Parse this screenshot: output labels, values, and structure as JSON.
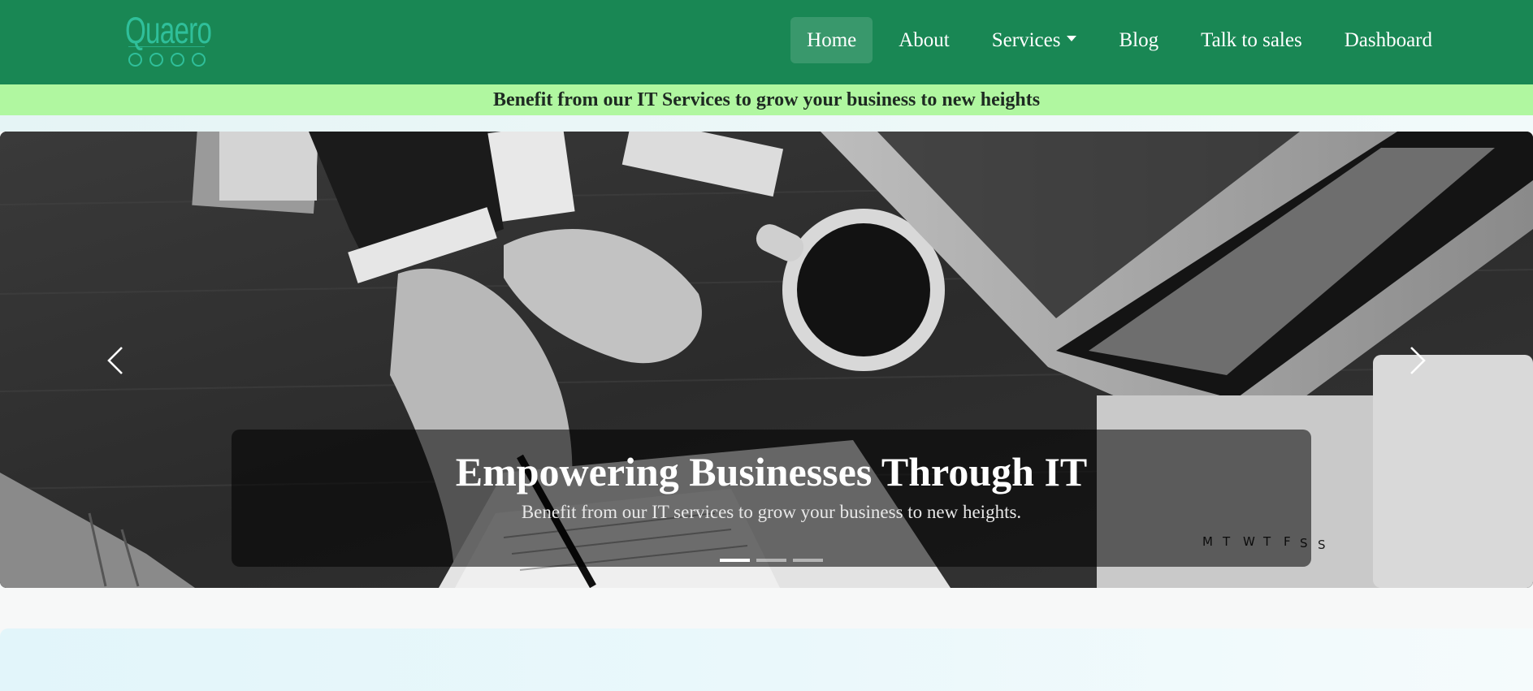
{
  "brand": {
    "logo_text": "Quaero",
    "color": "#2fbf9a"
  },
  "nav": {
    "background": "#198754",
    "items": [
      {
        "label": "Home",
        "active": true
      },
      {
        "label": "About",
        "active": false
      },
      {
        "label": "Services",
        "active": false,
        "dropdown": true
      },
      {
        "label": "Blog",
        "active": false
      },
      {
        "label": "Talk to sales",
        "active": false
      },
      {
        "label": "Dashboard",
        "active": false
      }
    ]
  },
  "banner": {
    "text": "Benefit from our IT Services to grow your business to new heights",
    "background": "#b0f7a0"
  },
  "carousel": {
    "slide": {
      "title": "Empowering Businesses Through IT",
      "subtitle": "Benefit from our IT services to grow your business to new heights.",
      "image": "business-desk-photo"
    },
    "indicators": [
      {
        "active": true
      },
      {
        "active": false
      },
      {
        "active": false
      }
    ],
    "prev_icon": "chevron-left-icon",
    "next_icon": "chevron-right-icon"
  }
}
